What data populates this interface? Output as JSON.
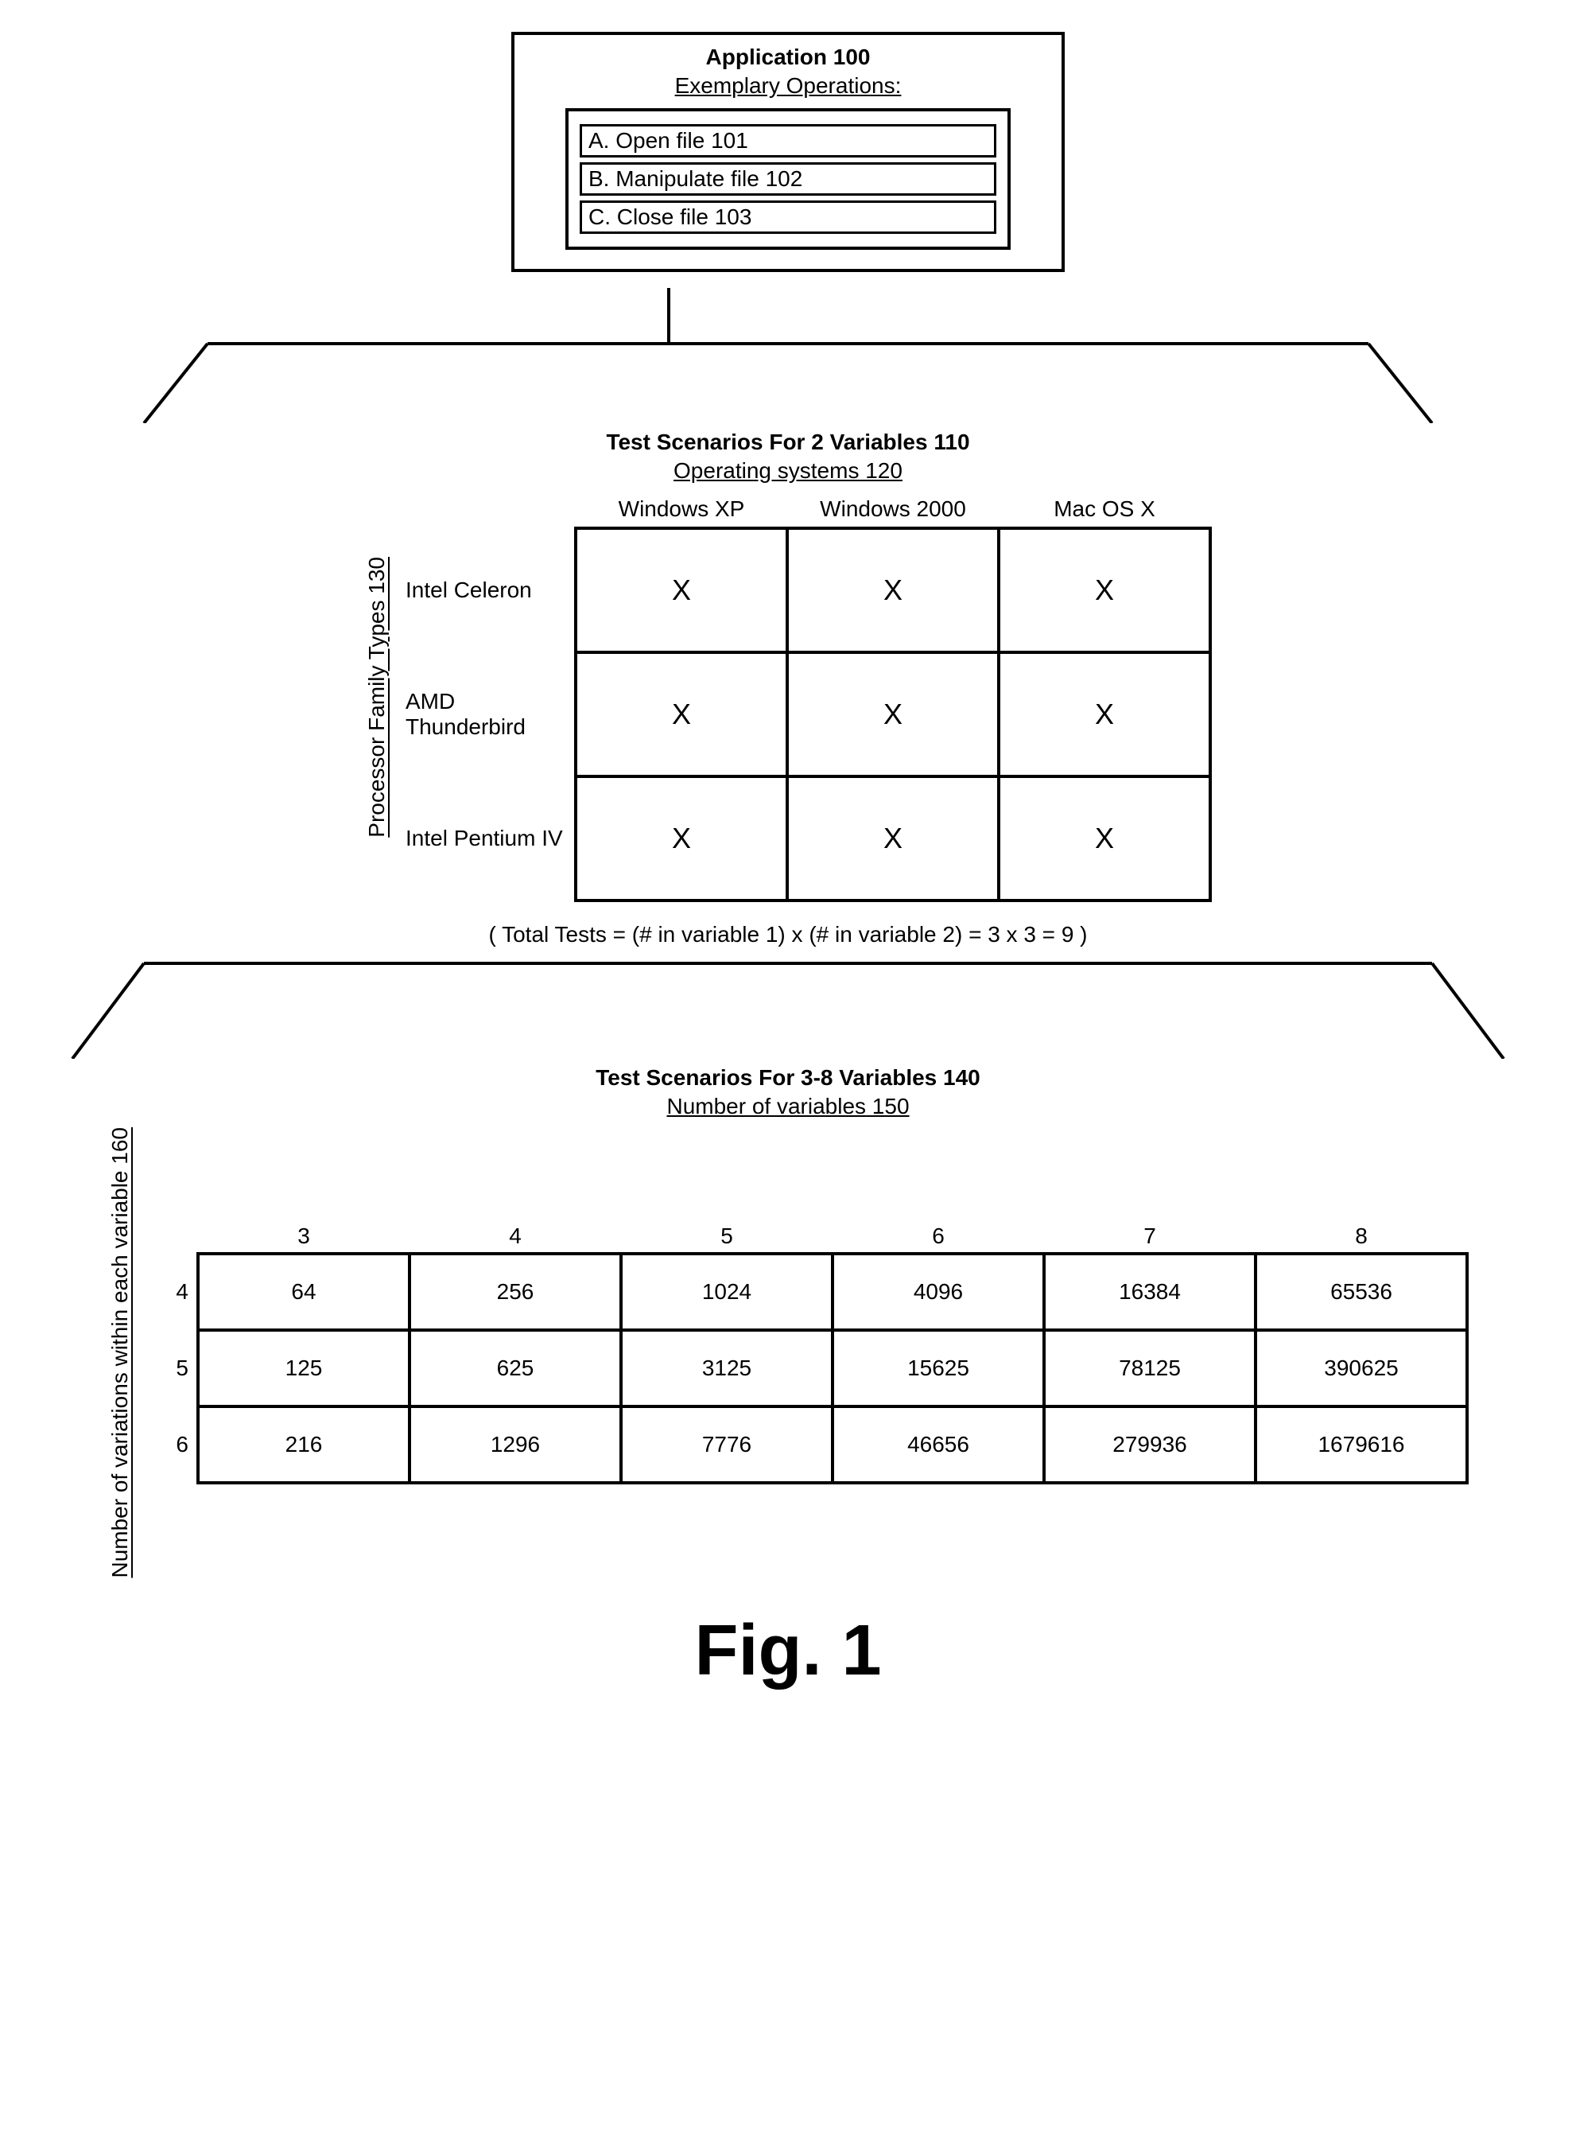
{
  "application": {
    "title": "Application 100",
    "subtitle": "Exemplary Operations:",
    "operations": [
      "A. Open file 101",
      "B. Manipulate file 102",
      "C. Close file 103"
    ]
  },
  "scenario1": {
    "title": "Test Scenarios For 2 Variables 110",
    "col_heading": "Operating systems 120",
    "row_heading": "Processor Family Types 130",
    "columns": [
      "Windows XP",
      "Windows 2000",
      "Mac OS X"
    ],
    "rows": [
      "Intel Celeron",
      "AMD Thunderbird",
      "Intel Pentium IV"
    ],
    "cell_mark": "X",
    "formula": "( Total Tests = (# in variable 1) x (# in variable 2) = 3 x 3 = 9 )"
  },
  "scenario2": {
    "title": "Test Scenarios For 3-8 Variables 140",
    "col_heading": "Number of variables 150",
    "row_heading": "Number of variations within each variable 160",
    "columns": [
      "3",
      "4",
      "5",
      "6",
      "7",
      "8"
    ],
    "rows": [
      "4",
      "5",
      "6"
    ],
    "cells": [
      [
        "64",
        "256",
        "1024",
        "4096",
        "16384",
        "65536"
      ],
      [
        "125",
        "625",
        "3125",
        "15625",
        "78125",
        "390625"
      ],
      [
        "216",
        "1296",
        "7776",
        "46656",
        "279936",
        "1679616"
      ]
    ]
  },
  "figure_label": "Fig. 1",
  "chart_data": [
    {
      "type": "table",
      "title": "Test Scenarios For 2 Variables 110",
      "x_dimension": "Operating systems 120",
      "y_dimension": "Processor Family Types 130",
      "columns": [
        "Windows XP",
        "Windows 2000",
        "Mac OS X"
      ],
      "rows": [
        "Intel Celeron",
        "AMD Thunderbird",
        "Intel Pentium IV"
      ],
      "values": [
        [
          "X",
          "X",
          "X"
        ],
        [
          "X",
          "X",
          "X"
        ],
        [
          "X",
          "X",
          "X"
        ]
      ],
      "annotation": "( Total Tests = (# in variable 1) x (# in variable 2) = 3 x 3 = 9 )"
    },
    {
      "type": "table",
      "title": "Test Scenarios For 3-8 Variables 140",
      "x_dimension": "Number of variables 150",
      "y_dimension": "Number of variations within each variable 160",
      "columns": [
        3,
        4,
        5,
        6,
        7,
        8
      ],
      "rows": [
        4,
        5,
        6
      ],
      "values": [
        [
          64,
          256,
          1024,
          4096,
          16384,
          65536
        ],
        [
          125,
          625,
          3125,
          15625,
          78125,
          390625
        ],
        [
          216,
          1296,
          7776,
          46656,
          279936,
          1679616
        ]
      ]
    }
  ]
}
